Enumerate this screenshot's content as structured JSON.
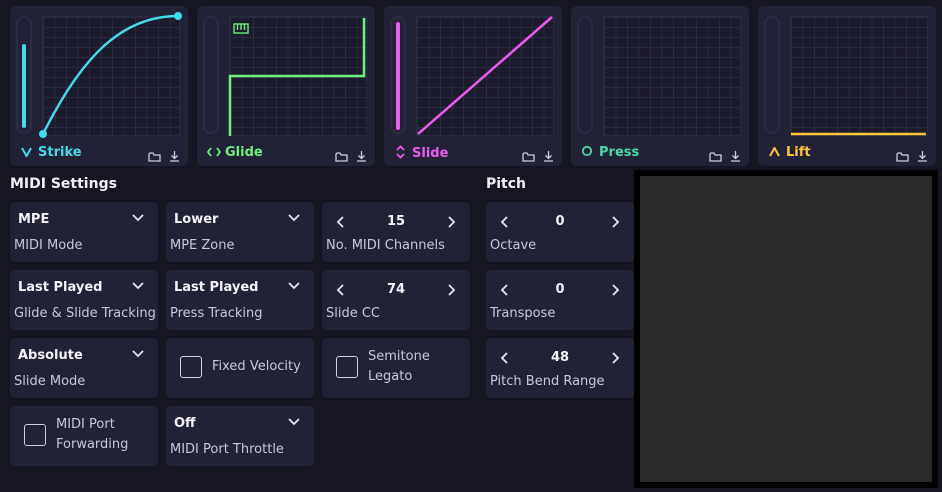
{
  "panels": [
    {
      "name": "Strike",
      "icon": "v-icon",
      "color": "#45d9ea"
    },
    {
      "name": "Glide",
      "icon": "code-brackets-icon",
      "color": "#6ef07e"
    },
    {
      "name": "Slide",
      "icon": "up-down-chevrons-icon",
      "color": "#ec5cec"
    },
    {
      "name": "Press",
      "icon": "circle-icon",
      "color": "#45d9a6"
    },
    {
      "name": "Lift",
      "icon": "caret-up-icon",
      "color": "#ffc53a"
    }
  ],
  "midi_settings": {
    "heading": "MIDI Settings",
    "midi_mode": {
      "value": "MPE",
      "caption": "MIDI Mode"
    },
    "mpe_zone": {
      "value": "Lower",
      "caption": "MPE Zone"
    },
    "midi_channels": {
      "value": "15",
      "caption": "No. MIDI Channels"
    },
    "glide_slide_tracking": {
      "value": "Last Played",
      "caption": "Glide & Slide Tracking"
    },
    "press_tracking": {
      "value": "Last Played",
      "caption": "Press Tracking"
    },
    "slide_cc": {
      "value": "74",
      "caption": "Slide CC"
    },
    "slide_mode": {
      "value": "Absolute",
      "caption": "Slide Mode"
    },
    "fixed_velocity": {
      "label": "Fixed Velocity",
      "checked": false
    },
    "semitone_legato": {
      "label_line1": "Semitone",
      "label_line2": "Legato",
      "checked": false
    },
    "midi_port_forwarding": {
      "label_line1": "MIDI Port",
      "label_line2": "Forwarding",
      "checked": false
    },
    "midi_port_throttle": {
      "value": "Off",
      "caption": "MIDI Port Throttle"
    }
  },
  "pitch": {
    "heading": "Pitch",
    "octave": {
      "value": "0",
      "caption": "Octave"
    },
    "transpose": {
      "value": "0",
      "caption": "Transpose"
    },
    "pitch_bend_range": {
      "value": "48",
      "caption": "Pitch Bend Range"
    }
  }
}
